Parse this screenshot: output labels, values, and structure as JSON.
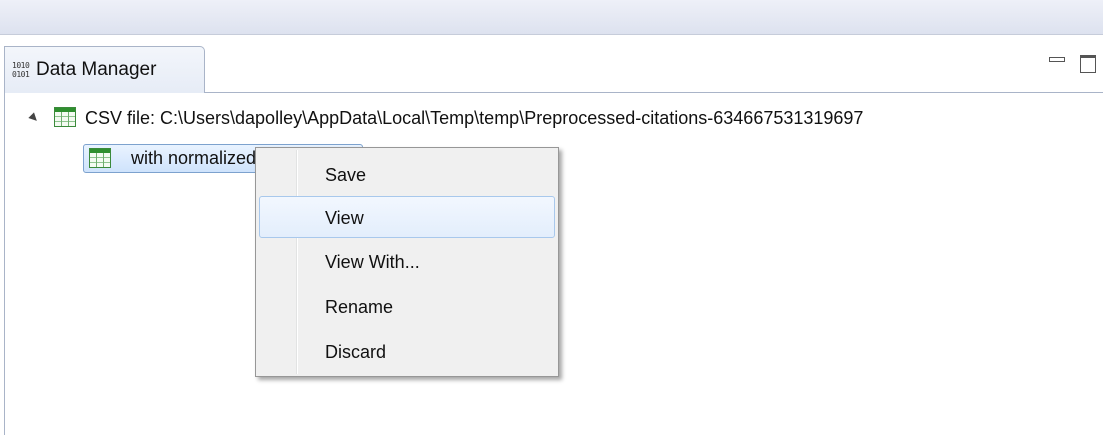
{
  "view": {
    "title": "Data Manager",
    "icon": "binary-data-icon",
    "icon_glyph": "1010\n0101"
  },
  "tree": {
    "items": [
      {
        "label": "CSV file: C:\\Users\\dapolley\\AppData\\Local\\Temp\\temp\\Preprocessed-citations-634667531319697",
        "icon": "table-icon",
        "expanded": true
      },
      {
        "label": "with normalized",
        "icon": "table-icon",
        "selected": true
      }
    ]
  },
  "context_menu": {
    "items": [
      {
        "label": "Save"
      },
      {
        "label": "View",
        "highlighted": true
      },
      {
        "label": "View With..."
      },
      {
        "label": "Rename"
      },
      {
        "label": "Discard"
      }
    ]
  },
  "colors": {
    "selection_fill": "#cfe3fc",
    "selection_border": "#7da2ce",
    "menu_bg": "#f0f0f0",
    "icon_green": "#2f8f2f"
  }
}
